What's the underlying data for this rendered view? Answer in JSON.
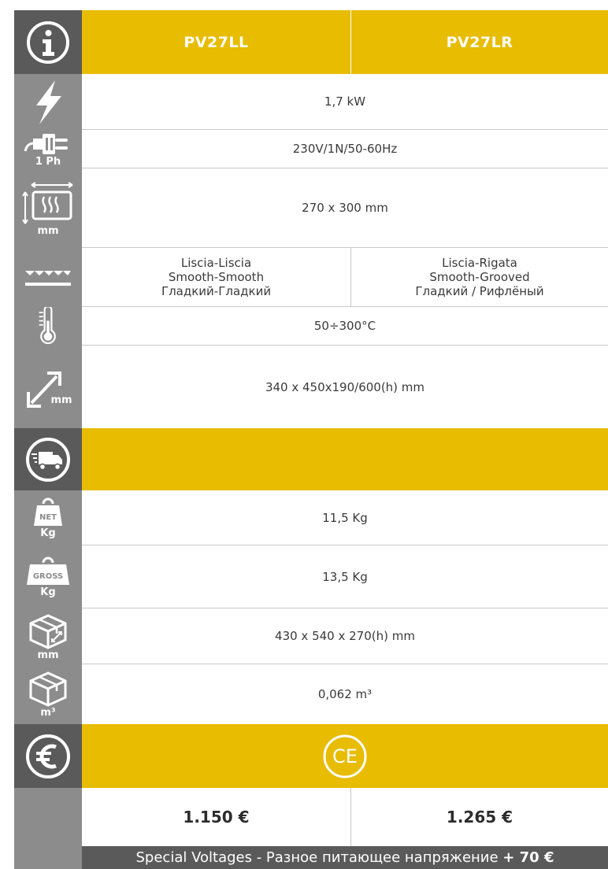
{
  "header": {
    "model_left": "PV27LL",
    "model_right": "PV27LR"
  },
  "specs": {
    "power": "1,7 kW",
    "power_supply_icon_label": "1 Ph",
    "voltage": "230V/1N/50-60Hz",
    "cooking_area_icon_label": "mm",
    "cooking_area": "270 x 300 mm",
    "surface_left": [
      "Liscia-Liscia",
      "Smooth-Smooth",
      "Гладкий-Гладкий"
    ],
    "surface_right": [
      "Liscia-Rigata",
      "Smooth-Grooved",
      "Гладкий / Рифлёный"
    ],
    "temperature": "50÷300°C",
    "dimensions_icon_label": "mm",
    "dimensions": "340 x 450x190/600(h) mm"
  },
  "shipping": {
    "net_icon_top": "NET",
    "net_icon_label": "Kg",
    "net_weight": "11,5 Kg",
    "gross_icon_top": "GROSS",
    "gross_icon_label": "Kg",
    "gross_weight": "13,5 Kg",
    "package_icon_label": "mm",
    "package_dimensions": "430 x 540 x 270(h) mm",
    "volume_icon_label": "m³",
    "volume": "0,062 m³"
  },
  "pricing": {
    "ce_mark": "CE",
    "price_left": "1.150 €",
    "price_right": "1.265 €",
    "special_voltages_text": "Special Voltages - Разное питающее напряжение ",
    "special_voltages_surcharge": "+ 70 €"
  },
  "colors": {
    "accent": "#e8bc00",
    "icon_bg": "#8c8c8c",
    "icon_bg_dark": "#5a5a5a"
  },
  "icons": [
    "info-icon",
    "lightning-icon",
    "plug-icon",
    "heating-plate-icon",
    "plate-surface-icon",
    "thermometer-icon",
    "dimensions-arrow-icon",
    "delivery-truck-icon",
    "net-weight-icon",
    "gross-weight-icon",
    "package-box-icon",
    "package-volume-icon",
    "euro-icon",
    "ce-mark-icon"
  ]
}
